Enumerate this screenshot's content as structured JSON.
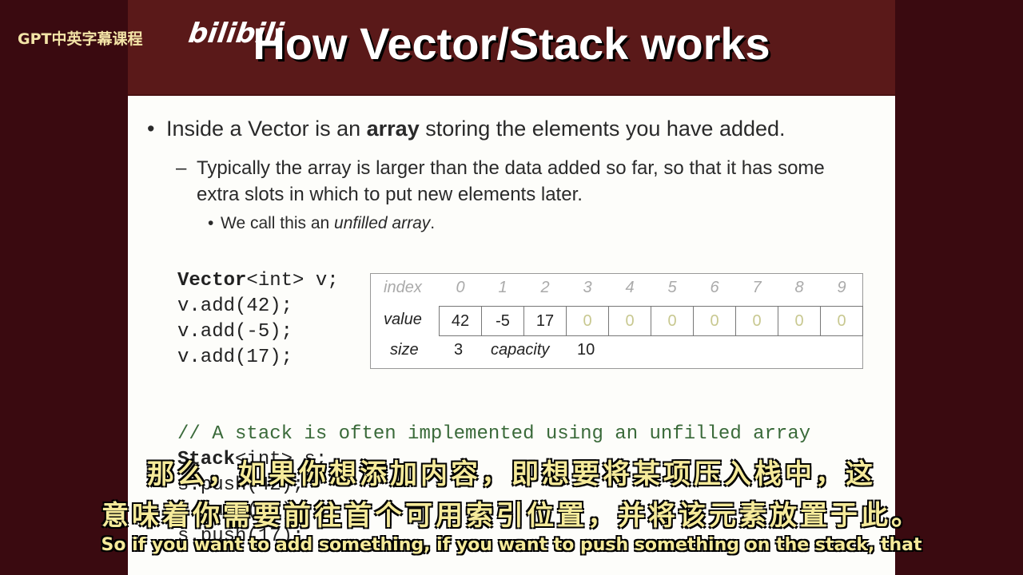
{
  "watermark": "GPT中英字幕课程",
  "bili_logo": "bilibili",
  "slide": {
    "title": "How Vector/Stack works",
    "bullet1_dot": "•",
    "bullet1_a": "Inside a Vector is an ",
    "bullet1_bold": "array",
    "bullet1_b": " storing the elements you have added.",
    "bullet2_dash": "–",
    "bullet2": "Typically the array is larger than the data added so far, so that it has some extra slots in which to put new elements later.",
    "bullet3_dot": "•",
    "bullet3_a": "We call this an ",
    "bullet3_italic": "unfilled array",
    "bullet3_b": "."
  },
  "code1": {
    "line1_kw": "Vector",
    "line1_rest": "<int> v;",
    "line2": "v.add(42);",
    "line3": "v.add(-5);",
    "line4": "v.add(17);"
  },
  "array": {
    "index_label": "index",
    "value_label": "value",
    "size_label": "size",
    "size_value": "3",
    "capacity_label": "capacity",
    "capacity_value": "10",
    "indices": [
      "0",
      "1",
      "2",
      "3",
      "4",
      "5",
      "6",
      "7",
      "8",
      "9"
    ],
    "values": [
      "42",
      "-5",
      "17",
      "0",
      "0",
      "0",
      "0",
      "0",
      "0",
      "0"
    ]
  },
  "code2": {
    "comment": "// A stack is often implemented using an unfilled array",
    "line1_kw": "Stack",
    "line1_rest": "<int> s;",
    "line2": "s.push(42);",
    "line3": "s.push(-5);",
    "line4": "s.push(17);"
  },
  "subtitles": {
    "cn_line1": "那么，如果你想添加内容，即想要将某项压入栈中，这",
    "cn_line2": "意味着你需要前往首个可用索引位置，并将该元素放置于此。",
    "en_line": "So if you want to add something, if you want to push something on the stack, that"
  }
}
